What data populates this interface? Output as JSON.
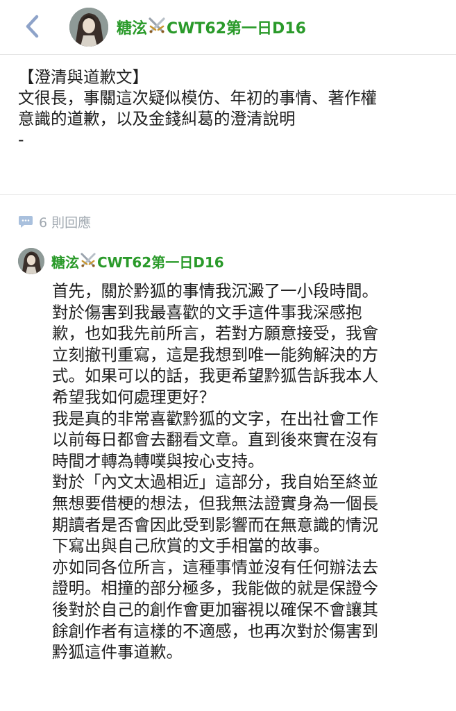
{
  "header": {
    "user_name": "糖泫",
    "user_tag": "CWT62第一日D16"
  },
  "post": {
    "lines": [
      "【澄清與道歉文】",
      "文很長，事關這次疑似模仿、年初的事情、著作權",
      "意識的道歉，以及金錢糾葛的澄清說明",
      "-"
    ]
  },
  "replies": {
    "count_label": "6 則回應"
  },
  "reply": {
    "user_name": "糖泫",
    "user_tag": "CWT62第一日D16",
    "lines": [
      "首先，關於黔狐的事情我沉澱了一小段時間。",
      "對於傷害到我最喜歡的文手這件事我深感抱",
      "歉，也如我先前所言，若對方願意接受，我會",
      "立刻撤刊重寫，這是我想到唯一能夠解決的方",
      "式。如果可以的話，我更希望黔狐告訴我本人",
      "希望我如何處理更好？",
      "我是真的非常喜歡黔狐的文字，在出社會工作",
      "以前每日都會去翻看文章。直到後來實在沒有",
      "時間才轉為轉噗與按心支持。",
      "對於「內文太過相近」這部分，我自始至終並",
      "無想要借梗的想法，但我無法證實身為一個長",
      "期讀者是否會因此受到影響而在無意識的情況",
      "下寫出與自己欣賞的文手相當的故事。",
      "亦如同各位所言，這種事情並沒有任何辦法去",
      "證明。相撞的部分極多，我能做的就是保證今",
      "後對於自己的創作會更加審視以確保不會讓其",
      "餘創作者有這樣的不適感，也再次對於傷害到",
      "黔狐這件事道歉。"
    ]
  },
  "icons": {
    "back": "chevron-left-icon",
    "sword": "crossed-swords-icon",
    "comment": "speech-bubble-icon"
  },
  "colors": {
    "name_green": "#2a9a2a",
    "muted_gray": "#a0a8b0",
    "back_blue": "#8ea3c9"
  }
}
